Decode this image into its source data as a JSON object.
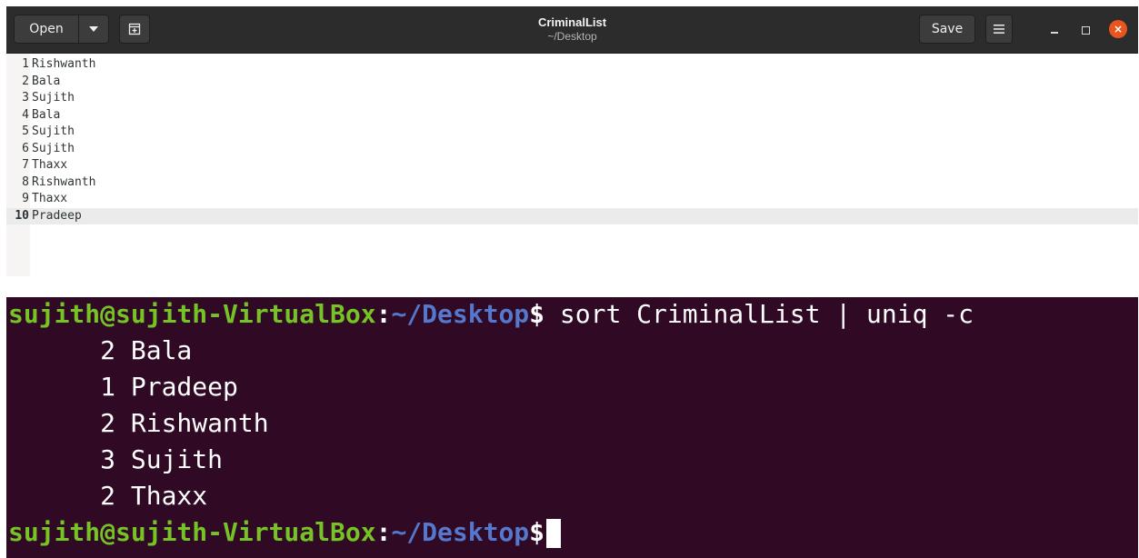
{
  "editor": {
    "open_label": "Open",
    "save_label": "Save",
    "title": "CriminalList",
    "subtitle": "~/Desktop",
    "close_glyph": "×",
    "current_line": 10,
    "lines": [
      {
        "num": "1",
        "text": "Rishwanth"
      },
      {
        "num": "2",
        "text": "Bala"
      },
      {
        "num": "3",
        "text": "Sujith"
      },
      {
        "num": "4",
        "text": "Bala"
      },
      {
        "num": "5",
        "text": "Sujith"
      },
      {
        "num": "6",
        "text": "Sujith"
      },
      {
        "num": "7",
        "text": "Thaxx"
      },
      {
        "num": "8",
        "text": "Rishwanth"
      },
      {
        "num": "9",
        "text": "Thaxx"
      },
      {
        "num": "10",
        "text": "Pradeep"
      }
    ]
  },
  "terminal": {
    "prompt_user": "sujith@sujith-VirtualBox",
    "prompt_colon": ":",
    "prompt_path": "~/Desktop",
    "prompt_symbol": "$",
    "command": " sort CriminalList | uniq -c",
    "output": [
      "      2 Bala",
      "      1 Pradeep",
      "      2 Rishwanth",
      "      3 Sujith",
      "      2 Thaxx"
    ]
  },
  "colors": {
    "terminal_bg": "#300a24",
    "prompt_user": "#76c326",
    "prompt_path": "#5577cc",
    "close_button": "#e95420"
  }
}
